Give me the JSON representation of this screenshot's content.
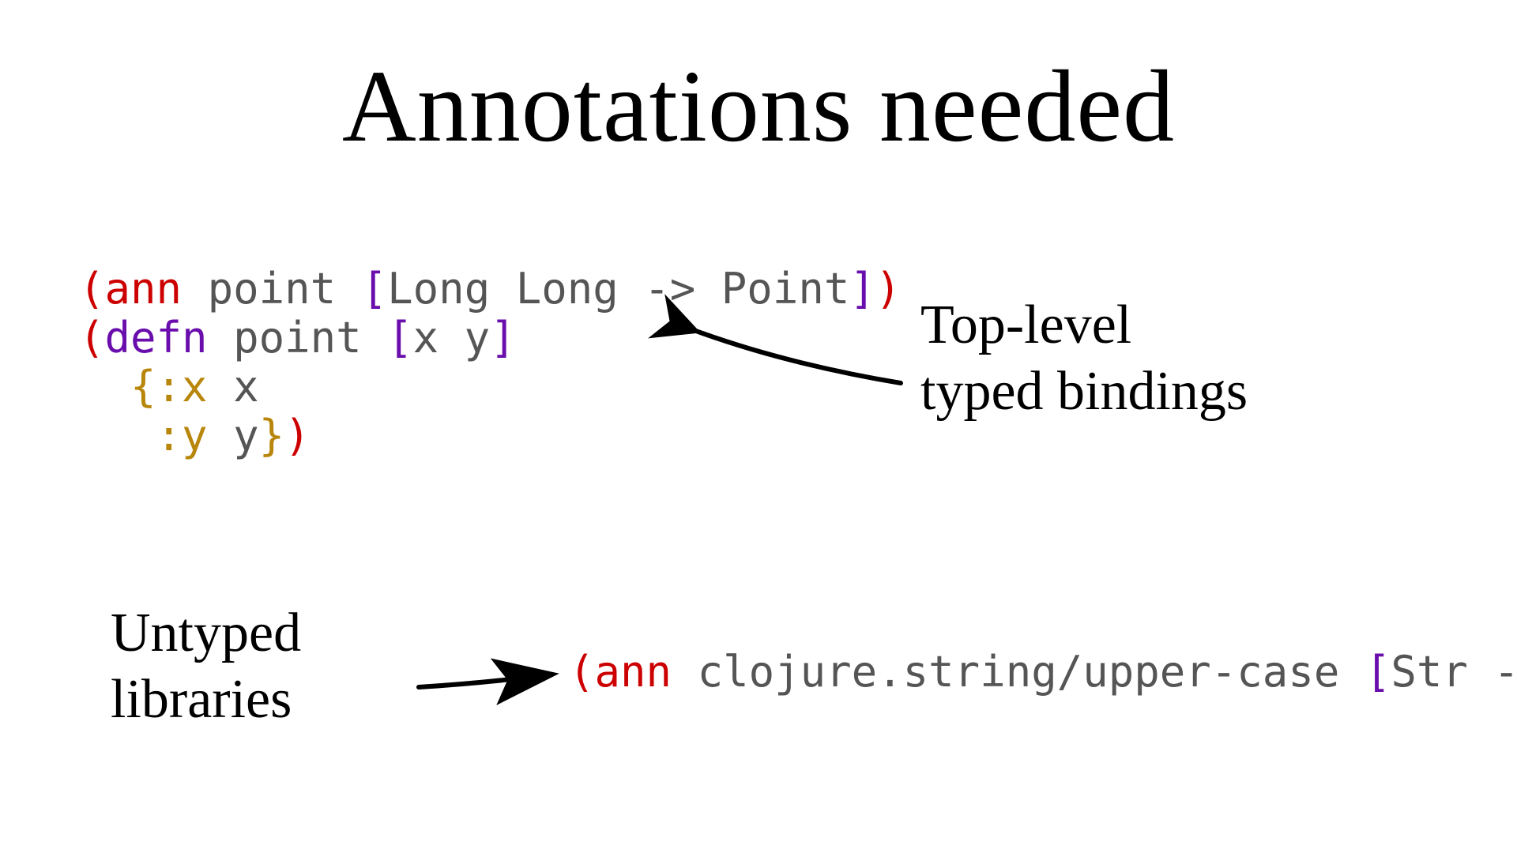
{
  "title": "Annotations needed",
  "code1": {
    "tokens": [
      {
        "t": "(",
        "c": "paren"
      },
      {
        "t": "ann",
        "c": "kw1"
      },
      {
        "t": " point ",
        "c": "sym"
      },
      {
        "t": "[",
        "c": "brack"
      },
      {
        "t": "Long Long -> Point",
        "c": "sym"
      },
      {
        "t": "]",
        "c": "brack"
      },
      {
        "t": ")",
        "c": "paren"
      },
      {
        "t": "\n",
        "c": ""
      },
      {
        "t": "(",
        "c": "paren"
      },
      {
        "t": "defn",
        "c": "kw2"
      },
      {
        "t": " point ",
        "c": "sym"
      },
      {
        "t": "[",
        "c": "brack"
      },
      {
        "t": "x y",
        "c": "sym"
      },
      {
        "t": "]",
        "c": "brack"
      },
      {
        "t": "\n",
        "c": ""
      },
      {
        "t": "  ",
        "c": ""
      },
      {
        "t": "{",
        "c": "brace"
      },
      {
        "t": ":x",
        "c": "key"
      },
      {
        "t": " x",
        "c": "sym"
      },
      {
        "t": "\n",
        "c": ""
      },
      {
        "t": "   ",
        "c": ""
      },
      {
        "t": ":y",
        "c": "key"
      },
      {
        "t": " y",
        "c": "sym"
      },
      {
        "t": "}",
        "c": "brace"
      },
      {
        "t": ")",
        "c": "paren"
      }
    ]
  },
  "code2": {
    "tokens": [
      {
        "t": "(",
        "c": "paren"
      },
      {
        "t": "ann",
        "c": "kw1"
      },
      {
        "t": " clojure.string/upper-case ",
        "c": "sym"
      },
      {
        "t": "[",
        "c": "brack"
      },
      {
        "t": "Str -> Str",
        "c": "sym"
      },
      {
        "t": "]",
        "c": "brack"
      },
      {
        "t": ")",
        "c": "paren"
      }
    ]
  },
  "label_top_line1": "Top-level",
  "label_top_line2": "typed bindings",
  "label_bottom_line1": "Untyped",
  "label_bottom_line2": "libraries"
}
